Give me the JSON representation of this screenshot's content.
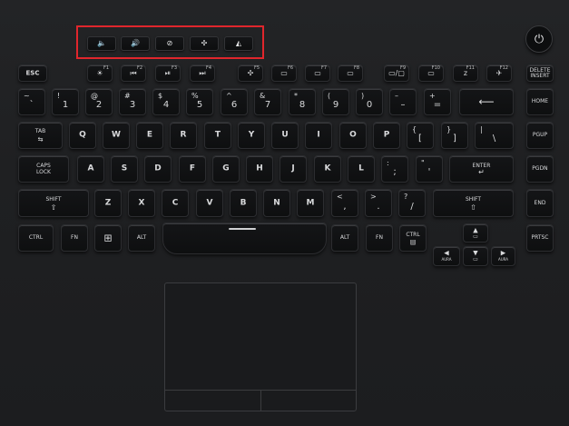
{
  "top_buttons": [
    {
      "name": "volume-down-button",
      "icon": "volume-low-icon",
      "glyph": "🔈"
    },
    {
      "name": "volume-up-button",
      "icon": "volume-high-icon",
      "glyph": "🔊"
    },
    {
      "name": "mic-mute-button",
      "icon": "mic-mute-icon",
      "glyph": "⊘"
    },
    {
      "name": "fan-mode-button",
      "icon": "fan-icon",
      "glyph": "✣"
    },
    {
      "name": "armoury-crate-button",
      "icon": "rog-logo-icon",
      "glyph": "◭"
    }
  ],
  "highlight_color": "#e0262c",
  "power": {
    "icon": "power-icon",
    "glyph": "⏻"
  },
  "fn_row": [
    {
      "main": "ESC"
    },
    {
      "main": "☀",
      "fn": "F1"
    },
    {
      "main": "⏮",
      "fn": "F2"
    },
    {
      "main": "⏯",
      "fn": "F3"
    },
    {
      "main": "⏭",
      "fn": "F4"
    },
    {
      "main": "✣",
      "fn": "F5"
    },
    {
      "main": "▭",
      "fn": "F6"
    },
    {
      "main": "▭",
      "fn": "F7"
    },
    {
      "main": "▭",
      "fn": "F8"
    },
    {
      "main": "▭/▢",
      "fn": "F9"
    },
    {
      "main": "▭",
      "fn": "F10"
    },
    {
      "main": "z",
      "fn": "F11"
    },
    {
      "main": "✈",
      "fn": "F12"
    },
    {
      "main": "DELETE",
      "sub": "INSERT"
    }
  ],
  "num_row": [
    {
      "top": "~",
      "bottom": "`"
    },
    {
      "top": "!",
      "bottom": "1"
    },
    {
      "top": "@",
      "bottom": "2"
    },
    {
      "top": "#",
      "bottom": "3"
    },
    {
      "top": "$",
      "bottom": "4"
    },
    {
      "top": "%",
      "bottom": "5"
    },
    {
      "top": "^",
      "bottom": "6"
    },
    {
      "top": "&",
      "bottom": "7"
    },
    {
      "top": "*",
      "bottom": "8"
    },
    {
      "top": "(",
      "bottom": "9"
    },
    {
      "top": ")",
      "bottom": "0"
    },
    {
      "top": "–",
      "bottom": "–"
    },
    {
      "top": "+",
      "bottom": "="
    },
    {
      "main": "⟵"
    },
    {
      "main": "HOME"
    }
  ],
  "tab_row": [
    {
      "main": "TAB",
      "sub": "⇆"
    },
    {
      "main": "Q"
    },
    {
      "main": "W"
    },
    {
      "main": "E"
    },
    {
      "main": "R"
    },
    {
      "main": "T"
    },
    {
      "main": "Y"
    },
    {
      "main": "U"
    },
    {
      "main": "I"
    },
    {
      "main": "O"
    },
    {
      "main": "P"
    },
    {
      "top": "{",
      "bottom": "["
    },
    {
      "top": "}",
      "bottom": "]"
    },
    {
      "top": "|",
      "bottom": "\\"
    },
    {
      "main": "PGUP"
    }
  ],
  "caps_row": [
    {
      "main": "CAPS",
      "sub": "LOCK"
    },
    {
      "main": "A"
    },
    {
      "main": "S"
    },
    {
      "main": "D"
    },
    {
      "main": "F"
    },
    {
      "main": "G"
    },
    {
      "main": "H"
    },
    {
      "main": "J"
    },
    {
      "main": "K"
    },
    {
      "main": "L"
    },
    {
      "top": ":",
      "bottom": ";"
    },
    {
      "top": "\"",
      "bottom": "'"
    },
    {
      "main": "ENTER",
      "sub": "↵"
    },
    {
      "main": "PGDN"
    }
  ],
  "shift_row": [
    {
      "main": "SHIFT",
      "sub": "⇧"
    },
    {
      "main": "Z"
    },
    {
      "main": "X"
    },
    {
      "main": "C"
    },
    {
      "main": "V"
    },
    {
      "main": "B"
    },
    {
      "main": "N"
    },
    {
      "main": "M"
    },
    {
      "top": "<",
      "bottom": ","
    },
    {
      "top": ">",
      "bottom": "."
    },
    {
      "top": "?",
      "bottom": "/"
    },
    {
      "main": "SHIFT",
      "sub": "⇧"
    },
    {
      "main": "END"
    }
  ],
  "bottom_row": [
    {
      "main": "CTRL"
    },
    {
      "main": "FN"
    },
    {
      "main": "⊞"
    },
    {
      "main": "ALT"
    },
    {
      "main": ""
    },
    {
      "main": "ALT"
    },
    {
      "main": "FN"
    },
    {
      "main": "CTRL",
      "sub": "▤"
    },
    {
      "main": "PRTSC"
    }
  ],
  "arrows": [
    {
      "main": "▲",
      "sub": "▭"
    },
    {
      "main": "◀",
      "sub": "AURA"
    },
    {
      "main": "▼",
      "sub": "▭"
    },
    {
      "main": "▶",
      "sub": "AURA"
    }
  ]
}
